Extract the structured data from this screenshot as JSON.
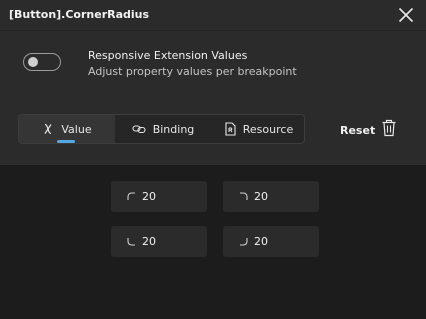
{
  "window": {
    "title": "[Button].CornerRadius"
  },
  "responsive": {
    "enabled": false,
    "title": "Responsive Extension Values",
    "subtitle": "Adjust property values per breakpoint"
  },
  "tabs": [
    {
      "label": "Value",
      "icon": "function-x-icon",
      "active": true
    },
    {
      "label": "Binding",
      "icon": "link-icon",
      "active": false
    },
    {
      "label": "Resource",
      "icon": "resource-file-icon",
      "active": false
    }
  ],
  "reset": {
    "label": "Reset",
    "icon": "trash-icon"
  },
  "corners": {
    "top_left": {
      "value": "20",
      "icon": "corner-top-left-icon"
    },
    "top_right": {
      "value": "20",
      "icon": "corner-top-right-icon"
    },
    "bottom_left": {
      "value": "20",
      "icon": "corner-bottom-left-icon"
    },
    "bottom_right": {
      "value": "20",
      "icon": "corner-bottom-right-icon"
    }
  },
  "colors": {
    "background": "#1c1c1c",
    "panel": "#2b2b2b",
    "accent": "#58a6e0",
    "text": "#f0f0f0"
  }
}
